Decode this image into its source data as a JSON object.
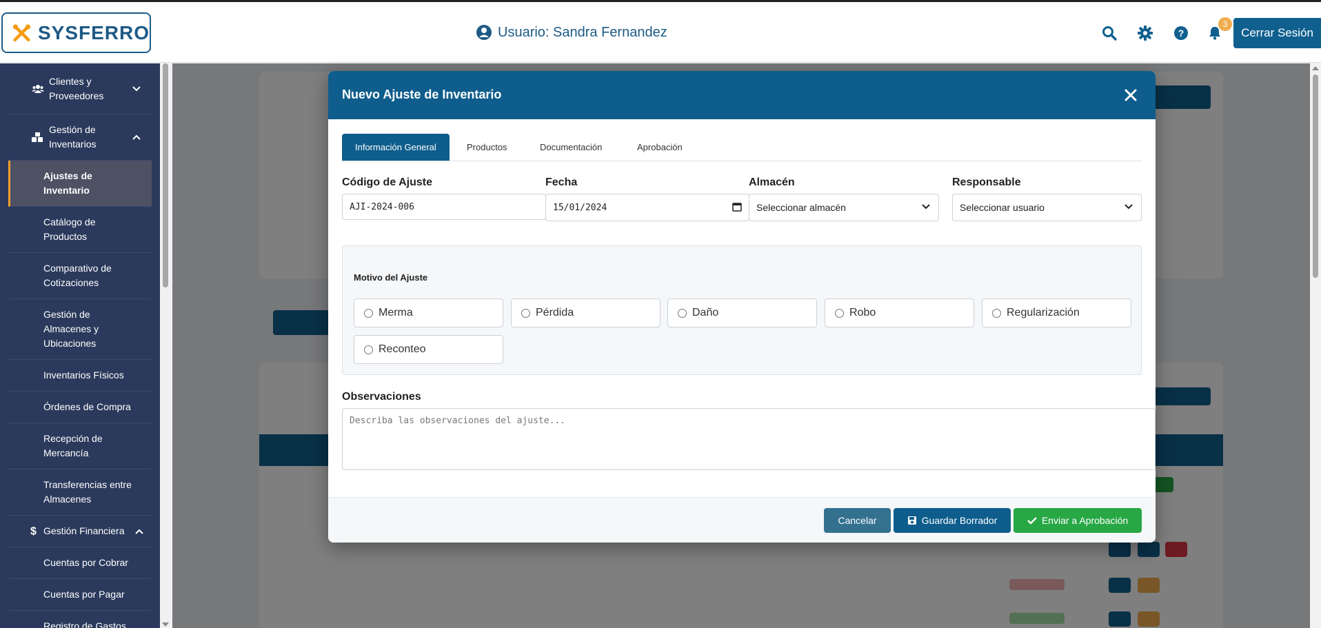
{
  "header": {
    "app_name": "SYSFERRO",
    "user_label": "Usuario: Sandra Fernandez",
    "notification_count": "3",
    "logout_label": "Cerrar Sesión"
  },
  "sidebar": {
    "groups": [
      {
        "label_lines": [
          "Clientes y",
          "Proveedores"
        ],
        "icon": "users-icon",
        "expanded": false
      },
      {
        "label_lines": [
          "Gestión de",
          "Inventarios"
        ],
        "icon": "boxes-icon",
        "expanded": true
      },
      {
        "label_lines": [
          "Gestión Financiera"
        ],
        "icon": "dollar-icon",
        "expanded": true
      }
    ],
    "inventory_items": [
      {
        "label_lines": [
          "Ajustes de",
          "Inventario"
        ],
        "active": true
      },
      {
        "label_lines": [
          "Catálogo de",
          "Productos"
        ]
      },
      {
        "label_lines": [
          "Comparativo de",
          "Cotizaciones"
        ]
      },
      {
        "label_lines": [
          "Gestión de",
          "Almacenes y",
          "Ubicaciones"
        ]
      },
      {
        "label_lines": [
          "Inventarios Físicos"
        ]
      },
      {
        "label_lines": [
          "Órdenes de Compra"
        ]
      },
      {
        "label_lines": [
          "Recepción de",
          "Mercancía"
        ]
      },
      {
        "label_lines": [
          "Transferencias entre",
          "Almacenes"
        ]
      }
    ],
    "finance_items": [
      {
        "label_lines": [
          "Cuentas por Cobrar"
        ]
      },
      {
        "label_lines": [
          "Cuentas por Pagar"
        ]
      },
      {
        "label_lines": [
          "Registro de Gastos"
        ]
      }
    ]
  },
  "modal": {
    "title": "Nuevo Ajuste de Inventario",
    "tabs": [
      "Información General",
      "Productos",
      "Documentación",
      "Aprobación"
    ],
    "active_tab": "Información General",
    "fields": {
      "codigo_label": "Código de Ajuste",
      "codigo_value": "AJI-2024-006",
      "fecha_label": "Fecha",
      "fecha_value": "15/01/2024",
      "almacen_label": "Almacén",
      "almacen_value": "Seleccionar almacén",
      "responsable_label": "Responsable",
      "responsable_value": "Seleccionar usuario"
    },
    "motivo": {
      "title": "Motivo del Ajuste",
      "options": [
        "Merma",
        "Pérdida",
        "Daño",
        "Robo",
        "Regularización",
        "Reconteo"
      ]
    },
    "observaciones": {
      "label": "Observaciones",
      "placeholder": "Describa las observaciones del ajuste..."
    },
    "buttons": {
      "cancel": "Cancelar",
      "save_draft": "Guardar Borrador",
      "submit": "Enviar a Aprobación"
    }
  },
  "colors": {
    "primary": "#0e5d8c",
    "sidebar_bg": "#2b3a5c",
    "accent": "#f0a030",
    "success": "#28a745",
    "cancel": "#33718f"
  }
}
